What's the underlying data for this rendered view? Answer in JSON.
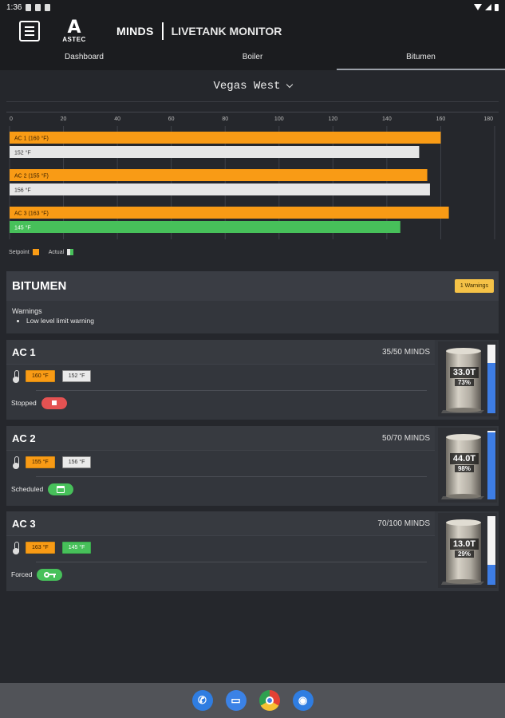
{
  "statusbar": {
    "time": "1:36"
  },
  "appbar": {
    "logo_text": "ASTEC",
    "logo_letter": "A",
    "brand": "MINDS",
    "subtitle": "LIVETANK MONITOR"
  },
  "tabs": [
    {
      "label": "Dashboard",
      "active": false
    },
    {
      "label": "Boiler",
      "active": false
    },
    {
      "label": "Bitumen",
      "active": true
    }
  ],
  "location": {
    "selected": "Vegas West"
  },
  "chart_data": {
    "type": "bar",
    "orientation": "horizontal",
    "x_ticks": [
      0,
      20,
      40,
      60,
      80,
      100,
      120,
      140,
      160,
      180
    ],
    "xlim": [
      0,
      180
    ],
    "grid": true,
    "groups": [
      {
        "setpoint": 160,
        "setpoint_label": "AC 1 (160 °F)",
        "actual": 152,
        "actual_label": "152 °F",
        "actual_color": "#e6e6e6"
      },
      {
        "setpoint": 155,
        "setpoint_label": "AC 2 (155 °F)",
        "actual": 156,
        "actual_label": "156 °F",
        "actual_color": "#e6e6e6"
      },
      {
        "setpoint": 163,
        "setpoint_label": "AC 3 (163 °F)",
        "actual": 145,
        "actual_label": "145 °F",
        "actual_color": "#47c05a"
      }
    ],
    "setpoint_color": "#f99b15",
    "legend": [
      {
        "label": "Setpoint"
      },
      {
        "label": "Actual"
      }
    ],
    "legend_position": "bottom-left"
  },
  "bitumen": {
    "title": "BITUMEN",
    "warning_badge": "1 Warnings",
    "warnings_heading": "Warnings",
    "warnings": [
      "Low level limit warning"
    ]
  },
  "tanks": [
    {
      "name": "AC 1",
      "minds": "35/50 MINDS",
      "setpoint": "160 °F",
      "actual": "152 °F",
      "actual_green": false,
      "status": "Stopped",
      "tonnes": "33.0T",
      "percent": "73%",
      "level": 0.73
    },
    {
      "name": "AC 2",
      "minds": "50/70 MINDS",
      "setpoint": "155 °F",
      "actual": "156 °F",
      "actual_green": false,
      "status": "Scheduled",
      "tonnes": "44.0T",
      "percent": "98%",
      "level": 0.98
    },
    {
      "name": "AC 3",
      "minds": "70/100 MINDS",
      "setpoint": "163 °F",
      "actual": "145 °F",
      "actual_green": true,
      "status": "Forced",
      "tonnes": "13.0T",
      "percent": "29%",
      "level": 0.29
    }
  ],
  "colors": {
    "accent": "#f99b15",
    "green": "#47c05a",
    "red": "#e45252",
    "level_blue": "#3d7de5",
    "warning": "#f5c247"
  },
  "navbar": {
    "icons": [
      "phone-icon",
      "messages-icon",
      "chrome-icon",
      "camera-icon"
    ]
  }
}
